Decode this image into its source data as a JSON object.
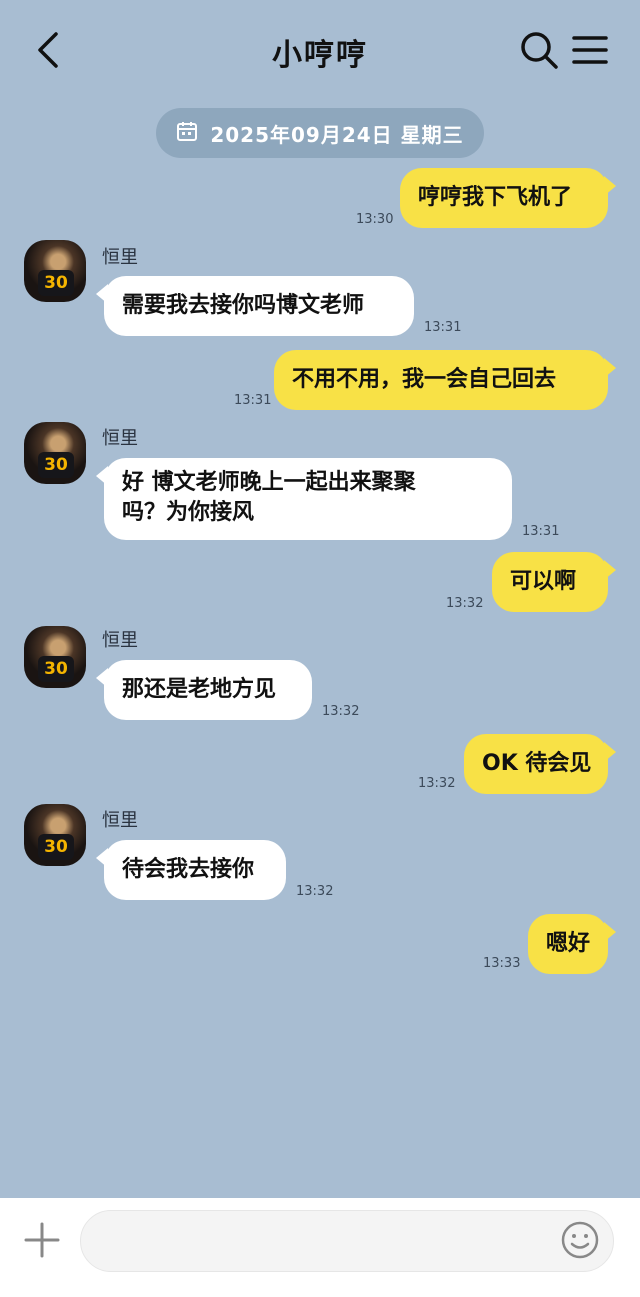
{
  "header": {
    "title": "小哼哼"
  },
  "date_separator": "2025年09月24日 星期三",
  "contact": {
    "name": "恒里",
    "jersey_number": "30"
  },
  "messages": [
    {
      "from": "me",
      "text": "哼哼我下飞机了",
      "time": "13:30"
    },
    {
      "from": "them",
      "text": "需要我去接你吗博文老师",
      "time": "13:31"
    },
    {
      "from": "me",
      "text": "不用不用，我一会自己回去",
      "time": "13:31"
    },
    {
      "from": "them",
      "text_line1": "好  博文老师晚上一起出来聚聚",
      "text_line2": "吗？为你接风",
      "time": "13:31"
    },
    {
      "from": "me",
      "text": "可以啊",
      "time": "13:32"
    },
    {
      "from": "them",
      "text": "那还是老地方见",
      "time": "13:32"
    },
    {
      "from": "me",
      "text": "OK 待会见",
      "time": "13:32"
    },
    {
      "from": "them",
      "text": "待会我去接你",
      "time": "13:32"
    },
    {
      "from": "me",
      "text": "嗯好",
      "time": "13:33"
    }
  ],
  "composer": {
    "value": ""
  },
  "colors": {
    "background": "#a8bdd2",
    "my_bubble": "#f8e146",
    "their_bubble": "#ffffff",
    "date_pill": "#8ea7bd"
  },
  "icons": [
    "back-arrow-icon",
    "search-icon",
    "menu-icon",
    "calendar-icon",
    "plus-icon",
    "emoji-icon"
  ]
}
